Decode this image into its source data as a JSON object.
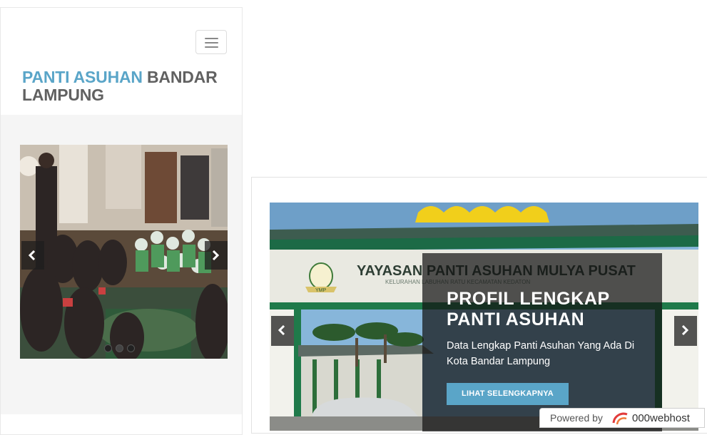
{
  "mobile": {
    "brand_accent": "PANTI ASUHAN",
    "brand_rest": " BANDAR LAMPUNG",
    "menu_icon": "hamburger-menu-icon",
    "carousel": {
      "prev_icon": "chevron-left-icon",
      "next_icon": "chevron-right-icon",
      "slide_count": 3,
      "active_slide": 2
    }
  },
  "hero": {
    "title": "PROFIL LENGKAP PANTI ASUHAN",
    "description": "Data Lengkap Panti Asuhan Yang Ada Di Kota Bandar Lampung",
    "button_label": "LIHAT SELENGKAPNYA",
    "prev_icon": "chevron-left-icon",
    "next_icon": "chevron-right-icon",
    "sign_text": "YAYASAN PANTI ASUHAN MULYA PUSAT",
    "sign_subtext": "KELURAHAN LABUHAN RATU KECAMATAN KEDATON",
    "sign_logo_text": "YMP"
  },
  "footer_badge": {
    "prefix": "Powered by",
    "host": "000webhost",
    "logo_icon": "000webhost-swirl-icon"
  },
  "colors": {
    "accent": "#5aa5c8",
    "text_dark": "#616161",
    "caption_bg": "#141414"
  }
}
